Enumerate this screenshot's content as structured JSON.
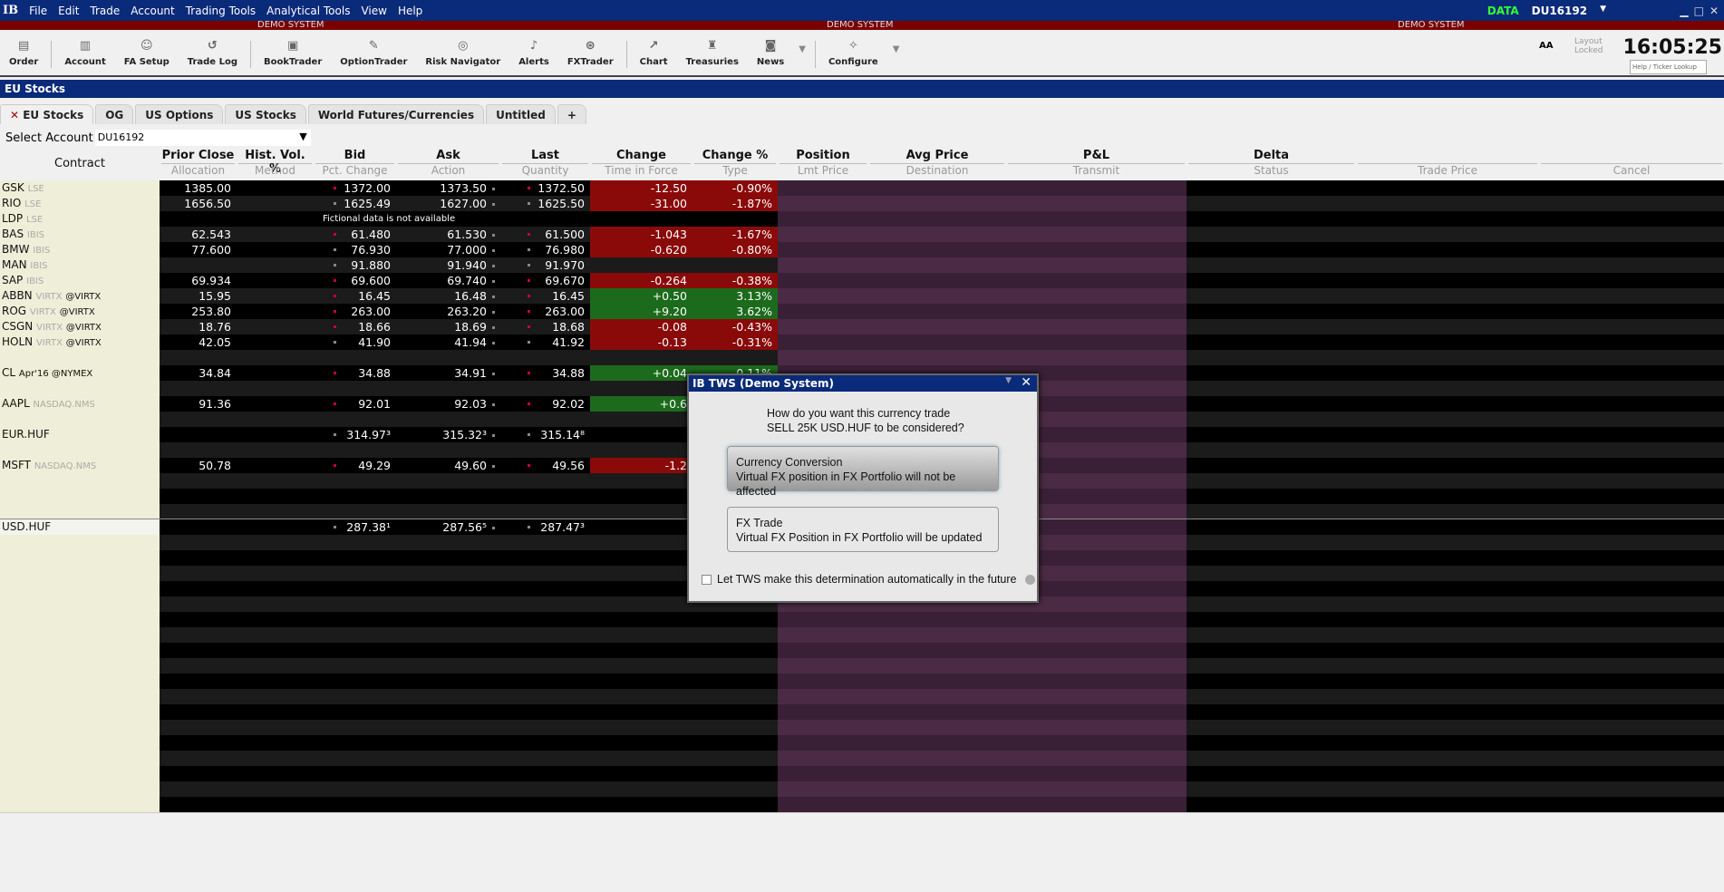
{
  "menubar": {
    "logo": "IB",
    "items": [
      "File",
      "Edit",
      "Trade",
      "Account",
      "Trading Tools",
      "Analytical Tools",
      "View",
      "Help"
    ],
    "data_label": "DATA",
    "account": "DU16192"
  },
  "demo_label": "DEMO SYSTEM",
  "toolbar": {
    "items": [
      {
        "label": "Order",
        "icon": "order-icon"
      },
      {
        "label": "Account",
        "icon": "account-icon"
      },
      {
        "label": "FA Setup",
        "icon": "fa-setup-icon"
      },
      {
        "label": "Trade Log",
        "icon": "trade-log-icon"
      },
      {
        "label": "BookTrader",
        "icon": "booktrader-icon"
      },
      {
        "label": "OptionTrader",
        "icon": "optiontrader-icon"
      },
      {
        "label": "Risk Navigator",
        "icon": "risk-navigator-icon"
      },
      {
        "label": "Alerts",
        "icon": "alerts-icon"
      },
      {
        "label": "FXTrader",
        "icon": "fxtrader-icon"
      },
      {
        "label": "Chart",
        "icon": "chart-icon"
      },
      {
        "label": "Treasuries",
        "icon": "treasuries-icon"
      },
      {
        "label": "News",
        "icon": "news-icon"
      },
      {
        "label": "Configure",
        "icon": "configure-icon"
      }
    ],
    "font_size_label": "AA",
    "layout_locked": "Layout Locked",
    "clock": "16:05:25",
    "lookup_placeholder": "Help / Ticker Lookup"
  },
  "window_title": "EU Stocks",
  "tabs": [
    "EU Stocks",
    "OG",
    "US Options",
    "US Stocks",
    "World Futures/Currencies",
    "Untitled",
    "+"
  ],
  "select_account": {
    "label": "Select Account",
    "value": "DU16192"
  },
  "columns": [
    {
      "top": "",
      "sub": "Contract"
    },
    {
      "top": "Prior Close",
      "sub": "Allocation"
    },
    {
      "top": "Hist. Vol. %",
      "sub": "Method"
    },
    {
      "top": "Bid",
      "sub": "Pct. Change"
    },
    {
      "top": "Ask",
      "sub": "Action"
    },
    {
      "top": "Last",
      "sub": "Quantity"
    },
    {
      "top": "Change",
      "sub": "Time in Force"
    },
    {
      "top": "Change %",
      "sub": "Type"
    },
    {
      "top": "Position",
      "sub": "Lmt Price"
    },
    {
      "top": "Avg Price",
      "sub": "Destination"
    },
    {
      "top": "P&L",
      "sub": "Transmit"
    },
    {
      "top": "Delta",
      "sub": "Status"
    },
    {
      "top": "",
      "sub": "Trade Price"
    },
    {
      "top": "",
      "sub": "Cancel"
    }
  ],
  "rows": [
    {
      "i": 0,
      "sym": "GSK",
      "ex": "LSE",
      "prior": "1385.00",
      "bid": "1372.00",
      "ask": "1373.50",
      "last": "1372.50",
      "chg": "-12.50",
      "pct": "-0.90%",
      "dir": "neg"
    },
    {
      "i": 1,
      "sym": "RIO",
      "ex": "LSE",
      "prior": "1656.50",
      "bid": "1625.49",
      "ask": "1627.00",
      "last": "1625.50",
      "chg": "-31.00",
      "pct": "-1.87%",
      "dir": "neg"
    },
    {
      "i": 2,
      "sym": "LDP",
      "ex": "LSE",
      "note": "Fictional data is not available"
    },
    {
      "i": 3,
      "sym": "BAS",
      "ex": "IBIS",
      "prior": "62.543",
      "bid": "61.480",
      "ask": "61.530",
      "last": "61.500",
      "chg": "-1.043",
      "pct": "-1.67%",
      "dir": "neg"
    },
    {
      "i": 4,
      "sym": "BMW",
      "ex": "IBIS",
      "prior": "77.600",
      "bid": "76.930",
      "ask": "77.000",
      "last": "76.980",
      "chg": "-0.620",
      "pct": "-0.80%",
      "dir": "neg"
    },
    {
      "i": 5,
      "sym": "MAN",
      "ex": "IBIS",
      "bid": "91.880",
      "ask": "91.940",
      "last": "91.970"
    },
    {
      "i": 6,
      "sym": "SAP",
      "ex": "IBIS",
      "prior": "69.934",
      "bid": "69.600",
      "ask": "69.740",
      "last": "69.670",
      "chg": "-0.264",
      "pct": "-0.38%",
      "dir": "neg"
    },
    {
      "i": 7,
      "sym": "ABBN",
      "ex": "VIRTX",
      "ex2": "@VIRTX",
      "prior": "15.95",
      "bid": "16.45",
      "ask": "16.48",
      "last": "16.45",
      "chg": "+0.50",
      "pct": "3.13%",
      "dir": "pos"
    },
    {
      "i": 8,
      "sym": "ROG",
      "ex": "VIRTX",
      "ex2": "@VIRTX",
      "prior": "253.80",
      "bid": "263.00",
      "ask": "263.20",
      "last": "263.00",
      "chg": "+9.20",
      "pct": "3.62%",
      "dir": "pos"
    },
    {
      "i": 9,
      "sym": "CSGN",
      "ex": "VIRTX",
      "ex2": "@VIRTX",
      "prior": "18.76",
      "bid": "18.66",
      "ask": "18.69",
      "last": "18.68",
      "chg": "-0.08",
      "pct": "-0.43%",
      "dir": "neg"
    },
    {
      "i": 10,
      "sym": "HOLN",
      "ex": "VIRTX",
      "ex2": "@VIRTX",
      "prior": "42.05",
      "bid": "41.90",
      "ask": "41.94",
      "last": "41.92",
      "chg": "-0.13",
      "pct": "-0.31%",
      "dir": "neg"
    },
    {
      "i": 12,
      "sym": "CL",
      "ex2": "Apr'16 @NYMEX",
      "prior": "34.84",
      "bid": "34.88",
      "ask": "34.91",
      "last": "34.88",
      "chg": "+0.04",
      "pct": "0.11%",
      "dir": "pos"
    },
    {
      "i": 14,
      "sym": "AAPL",
      "ex": "NASDAQ.NMS",
      "prior": "91.36",
      "bid": "92.01",
      "ask": "92.03",
      "last": "92.02",
      "chg": "+0.6",
      "dir": "pos"
    },
    {
      "i": 16,
      "sym": "EUR.HUF",
      "bid": "314.97³",
      "ask": "315.32³",
      "last": "315.14⁸"
    },
    {
      "i": 18,
      "sym": "MSFT",
      "ex": "NASDAQ.NMS",
      "prior": "50.78",
      "bid": "49.29",
      "ask": "49.60",
      "last": "49.56",
      "chg": "-1.2",
      "dir": "neg"
    },
    {
      "i": 22,
      "sym": "USD.HUF",
      "bid": "287.38¹",
      "ask": "287.56⁵",
      "last": "287.47³",
      "selected": true
    }
  ],
  "dialog": {
    "title": "IB TWS (Demo System)",
    "question_line1": "How do you want this currency trade",
    "question_line2": "SELL 25K USD.HUF to be considered?",
    "option1_title": "Currency Conversion",
    "option1_desc": "Virtual FX position in FX Portfolio will not be affected",
    "option2_title": "FX Trade",
    "option2_desc": "Virtual FX Position in FX Portfolio will be updated",
    "auto_label": "Let TWS make this determination automatically in the future",
    "auto_checked": false
  },
  "colors": {
    "menubar": "#0a2a7a",
    "demo_bar": "#7a0000",
    "negative": "#8a0a0a",
    "positive": "#1c6b1c",
    "contract_bg": "#efeed8"
  }
}
